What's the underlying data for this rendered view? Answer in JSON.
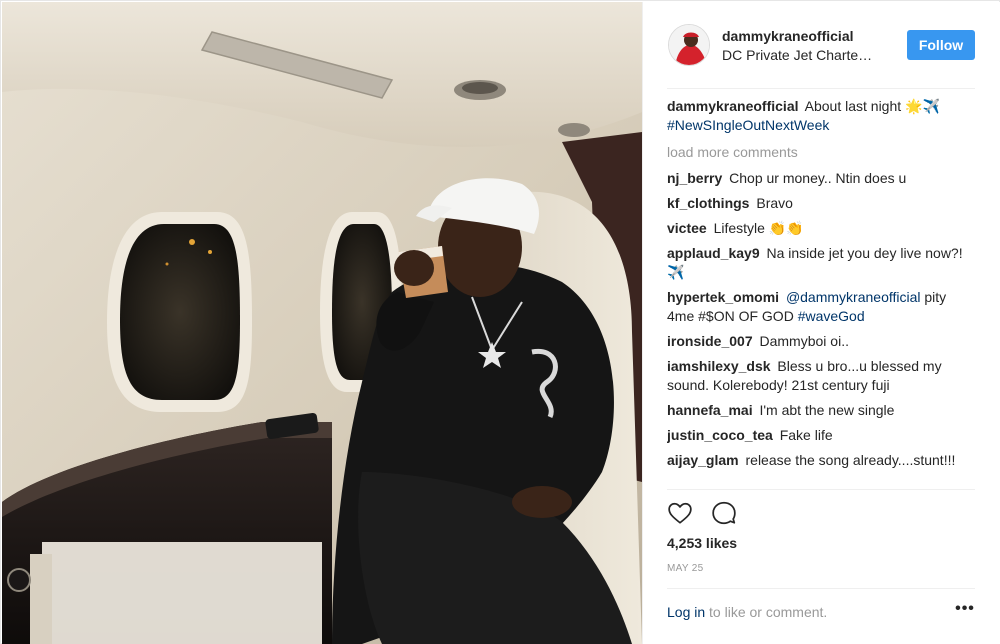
{
  "post": {
    "owner": {
      "username": "dammykraneofficial",
      "location": "DC Private Jet Charte…"
    },
    "follow_label": "Follow",
    "caption": {
      "username": "dammykraneofficial",
      "text": "About last night 🌟✈️",
      "hashtag": "#NewSIngleOutNextWeek"
    },
    "load_more_label": "load more comments",
    "comments": [
      {
        "user": "nj_berry",
        "text": "Chop ur money.. Ntin does u"
      },
      {
        "user": "kf_clothings",
        "text": "Bravo"
      },
      {
        "user": "victee",
        "text": "Lifestyle 👏👏"
      },
      {
        "user": "applaud_kay9",
        "text": "Na inside jet you dey live now?!✈️"
      },
      {
        "user": "hypertek_omomi",
        "mention": "@dammykraneofficial",
        "text": "pity 4me #$ON OF GOD",
        "hashtag": "#waveGod"
      },
      {
        "user": "ironside_007",
        "text": "Dammyboi oi.."
      },
      {
        "user": "iamshilexy_dsk",
        "text": "Bless u bro...u blessed my sound. Kolerebody! 21st century fuji"
      },
      {
        "user": "hannefa_mai",
        "text": "I'm abt the new single"
      },
      {
        "user": "justin_coco_tea",
        "text": "Fake life"
      },
      {
        "user": "aijay_glam",
        "text": "release the song already....stunt!!!"
      }
    ],
    "likes_label": "4,253 likes",
    "date_label": "MAY 25",
    "login_link": "Log in",
    "login_suffix": " to like or comment.",
    "more_label": "•••",
    "icons": [
      "heart-icon",
      "comment-icon",
      "more-options-icon"
    ],
    "colors": {
      "follow": "#3897f0",
      "link": "#003569",
      "muted": "#999999"
    }
  }
}
